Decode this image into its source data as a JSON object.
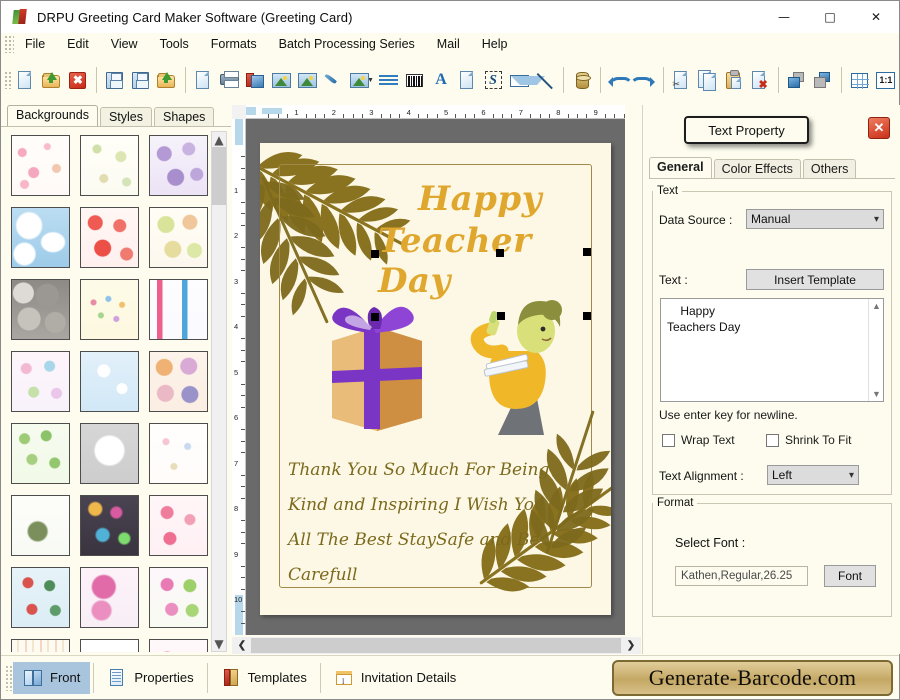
{
  "window": {
    "title": "DRPU Greeting Card Maker Software (Greeting Card)",
    "minimize": "—",
    "maximize": "❐",
    "close": "✕",
    "app_icon": "book-icon"
  },
  "menubar": {
    "items": [
      {
        "label": "File"
      },
      {
        "label": "Edit"
      },
      {
        "label": "View"
      },
      {
        "label": "Tools"
      },
      {
        "label": "Formats"
      },
      {
        "label": "Batch Processing Series"
      },
      {
        "label": "Mail"
      },
      {
        "label": "Help"
      }
    ]
  },
  "toolbar": {
    "overflow_label": "»",
    "buttons": [
      {
        "name": "new-document-icon",
        "tip": "New"
      },
      {
        "name": "open-folder-icon",
        "tip": "Open"
      },
      {
        "name": "close-red-x-icon",
        "tip": "Close"
      },
      {
        "name": "save-disk-icon",
        "tip": "Save"
      },
      {
        "name": "save-as-disk-icon",
        "tip": "Save As"
      },
      {
        "name": "import-folder-icon",
        "tip": "Import"
      },
      {
        "name": "page-setup-icon",
        "tip": "Page Setup"
      },
      {
        "name": "print-icon",
        "tip": "Print"
      },
      {
        "name": "card-layers-icon",
        "tip": "Card Properties"
      },
      {
        "name": "background-picture-icon",
        "tip": "Background"
      },
      {
        "name": "insert-image-icon",
        "tip": "Insert Image"
      },
      {
        "name": "quill-pen-icon",
        "tip": "Pen"
      },
      {
        "name": "shape-picture-dropdown-icon",
        "tip": "Shapes"
      },
      {
        "name": "watermark-icon",
        "tip": "Watermark"
      },
      {
        "name": "barcode-icon",
        "tip": "Barcode"
      },
      {
        "name": "text-a-icon",
        "tip": "Text"
      },
      {
        "name": "text-page-icon",
        "tip": "Text Page"
      },
      {
        "name": "signature-s-icon",
        "tip": "Signature"
      },
      {
        "name": "envelope-icon",
        "tip": "Mail"
      },
      {
        "name": "line-icon",
        "tip": "Line"
      },
      {
        "name": "database-icon",
        "tip": "Database"
      },
      {
        "name": "undo-icon",
        "tip": "Undo"
      },
      {
        "name": "redo-icon",
        "tip": "Redo"
      },
      {
        "name": "cut-icon",
        "tip": "Cut"
      },
      {
        "name": "copy-icon",
        "tip": "Copy"
      },
      {
        "name": "paste-icon",
        "tip": "Paste"
      },
      {
        "name": "delete-icon",
        "tip": "Delete"
      },
      {
        "name": "bring-to-front-icon",
        "tip": "Bring To Front"
      },
      {
        "name": "send-to-back-icon",
        "tip": "Send To Back"
      },
      {
        "name": "grid-icon",
        "tip": "Grid"
      },
      {
        "name": "zoom-one-to-one-icon",
        "tip": "1:1"
      }
    ],
    "one_to_one_label": "1:1"
  },
  "left_panel": {
    "tabs": [
      {
        "label": "Backgrounds",
        "active": true
      },
      {
        "label": "Styles",
        "active": false
      },
      {
        "label": "Shapes",
        "active": false
      }
    ],
    "scroll_up": "⌃",
    "scroll_down": "⌄",
    "thumbnails": [
      [
        "baby-pink-doodles",
        "green-pastel-doodles",
        "purple-floral-burst"
      ],
      [
        "blue-sky-clouds",
        "red-strawberries",
        "yellow-green-fruit"
      ],
      [
        "grey-stone-pebbles",
        "cream-confetti-dots",
        "gift-boxes-pattern"
      ],
      [
        "pastel-flower-mix",
        "blue-snowflakes",
        "orange-circle-medallions"
      ],
      [
        "green-pine-trees",
        "white-heart-wreath",
        "white-party-doodles"
      ],
      [
        "white-green-bow",
        "dark-bokeh-lights",
        "pink-hearts-pattern"
      ],
      [
        "santa-winter-pattern",
        "pink-pompom-floral",
        "pink-green-blossom"
      ],
      [
        "cream-stripes",
        "teddy-bear-white",
        "pink-butterfly-floral"
      ]
    ]
  },
  "canvas": {
    "ruler_h_labels": [
      "1",
      "2",
      "3",
      "4",
      "5",
      "6",
      "7",
      "8",
      "9"
    ],
    "ruler_v_labels": [
      "1",
      "2",
      "3",
      "4",
      "5",
      "6",
      "7",
      "8",
      "9",
      "10"
    ],
    "scroll_left": "❮",
    "scroll_right": "❯",
    "card": {
      "heading_line1": "Happy",
      "heading_line2": "Teacher Day",
      "message_lines": [
        "Thank You So Much For Being",
        "Kind and Inspiring I Wish You",
        "All The Best StaySafe and Be",
        "Carefull"
      ],
      "art": [
        "palm-frond-top-left",
        "gift-box-purple-ribbon",
        "teacher-woman-illustration",
        "palm-frond-bottom-right"
      ],
      "selection_handles": 8
    }
  },
  "right_panel": {
    "title": "Text Property",
    "close_label": "✕",
    "tabs": [
      {
        "label": "General",
        "active": true
      },
      {
        "label": "Color Effects",
        "active": false
      },
      {
        "label": "Others",
        "active": false
      }
    ],
    "text_group": {
      "legend": "Text",
      "data_source_label": "Data Source :",
      "data_source_value": "Manual",
      "data_source_options": [
        "Manual"
      ],
      "text_label": "Text :",
      "insert_template_label": "Insert Template",
      "text_value": "    Happy\nTeachers Day",
      "hint": "Use enter key for newline.",
      "wrap_text_label": "Wrap Text",
      "wrap_text_checked": false,
      "shrink_to_fit_label": "Shrink To Fit",
      "shrink_to_fit_checked": false,
      "text_alignment_label": "Text Alignment :",
      "text_alignment_value": "Left",
      "text_alignment_options": [
        "Left"
      ],
      "scroll_up": "⌃",
      "scroll_down": "⌄",
      "chevron": "⌄"
    },
    "format_group": {
      "legend": "Format",
      "select_font_label": "Select Font :",
      "font_value": "Kathen,Regular,26.25",
      "font_button_label": "Font"
    }
  },
  "bottom_bar": {
    "buttons": [
      {
        "label": "Front",
        "icon": "front-card-icon",
        "active": true
      },
      {
        "label": "Properties",
        "icon": "properties-page-icon",
        "active": false
      },
      {
        "label": "Templates",
        "icon": "templates-book-icon",
        "active": false
      },
      {
        "label": "Invitation Details",
        "icon": "invitation-details-icon",
        "active": false
      }
    ],
    "brand": "Generate-Barcode.com"
  },
  "colors": {
    "app_background": "#fdfcee",
    "card_background": "#fdf8e6",
    "stage_background": "#6a6a6a",
    "heading_gold": "#e0a72e",
    "message_olive": "#7b6a1d",
    "frond_olive": "#8a7320",
    "ribbon_purple": "#7b35c4",
    "brand_gold": "#c4a865",
    "accent_blue": "#a9c4dd"
  }
}
